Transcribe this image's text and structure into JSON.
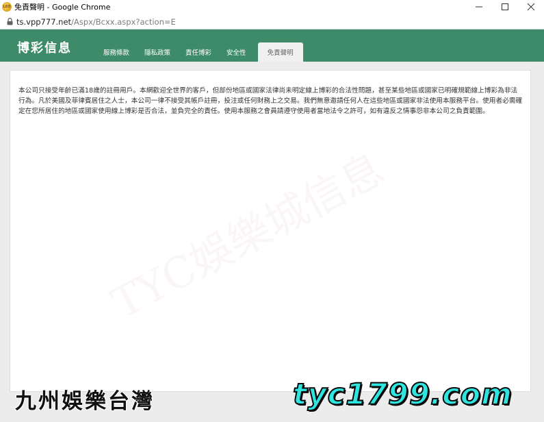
{
  "window": {
    "title": "免責聲明 - Google Chrome",
    "app_icon_text": "LEO"
  },
  "address": {
    "host": "ts.vpp777.net",
    "path": "/Aspx/Bcxx.aspx?action=E"
  },
  "site": {
    "brand": "博彩信息",
    "tabs": [
      {
        "label": "服務條款",
        "active": false
      },
      {
        "label": "隱私政策",
        "active": false
      },
      {
        "label": "責任博彩",
        "active": false
      },
      {
        "label": "安全性",
        "active": false
      },
      {
        "label": "免責聲明",
        "active": true
      }
    ],
    "accent_color": "#3d8b68"
  },
  "content": {
    "notice_text": "本公司只接受年齡已滿18歲的註冊用戶。本網歡迎全世界的客戶，但部份地區或國家法律尚未明定線上博彩的合法性問題，甚至某些地區或國家已明確規範線上博彩為非法行為。凡於美國及菲律賓居住之人士，本公司一律不接受其帳戶註冊，投注或任何財務上之交易。我們無意邀請任何人在這些地區或國家非法使用本服務平台。使用者必需確定在您所居住的地區或國家使用線上博彩是否合法，並負完全的責任。使用本服務之會員請遵守使用者當地法令之許可，如有違反之情事怨非本公司之負責範圍。",
    "watermark": "TYC娛樂城信息"
  },
  "overlay": {
    "left_text": "九州娛樂台灣",
    "right_text": "tyc1799.com"
  }
}
